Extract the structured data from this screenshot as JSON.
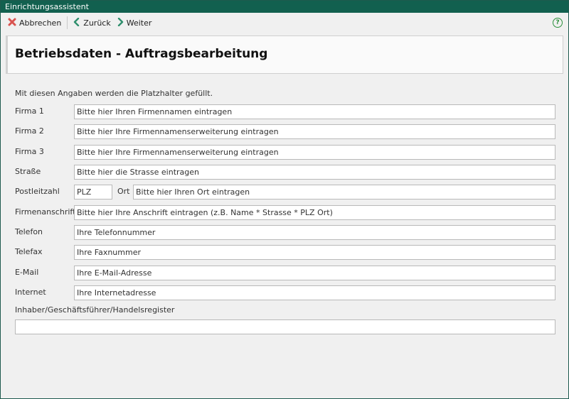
{
  "window": {
    "title": "Einrichtungsassistent"
  },
  "toolbar": {
    "cancel": "Abbrechen",
    "back": "Zurück",
    "next": "Weiter",
    "help": "?"
  },
  "header": {
    "title": "Betriebsdaten - Auftragsbearbeitung"
  },
  "intro": "Mit diesen Angaben werden die Platzhalter gefüllt.",
  "fields": {
    "firma1": {
      "label": "Firma 1",
      "value": "Bitte hier Ihren Firmennamen eintragen"
    },
    "firma2": {
      "label": "Firma 2",
      "value": "Bitte hier Ihre Firmennamenserweiterung eintragen"
    },
    "firma3": {
      "label": "Firma 3",
      "value": "Bitte hier Ihre Firmennamenserweiterung eintragen"
    },
    "strasse": {
      "label": "Straße",
      "value": "Bitte hier die Strasse eintragen"
    },
    "plz": {
      "label": "Postleitzahl",
      "value": "PLZ"
    },
    "ort": {
      "label": "Ort",
      "value": "Bitte hier Ihren Ort eintragen"
    },
    "anschrift": {
      "label": "Firmenanschrift",
      "value": "Bitte hier Ihre Anschrift eintragen (z.B. Name * Strasse * PLZ Ort)"
    },
    "telefon": {
      "label": "Telefon",
      "value": "Ihre Telefonnummer"
    },
    "telefax": {
      "label": "Telefax",
      "value": "Ihre Faxnummer"
    },
    "email": {
      "label": "E-Mail",
      "value": "Ihre E-Mail-Adresse"
    },
    "internet": {
      "label": "Internet",
      "value": "Ihre Internetadresse"
    },
    "inhaber": {
      "label": "Inhaber/Geschäftsführer/Handelsregister",
      "value": ""
    }
  },
  "colors": {
    "titlebar": "#12604f",
    "cancel_icon": "#d9534f",
    "nav_icon": "#2f8f6d",
    "help_icon": "#2a8f3a"
  }
}
